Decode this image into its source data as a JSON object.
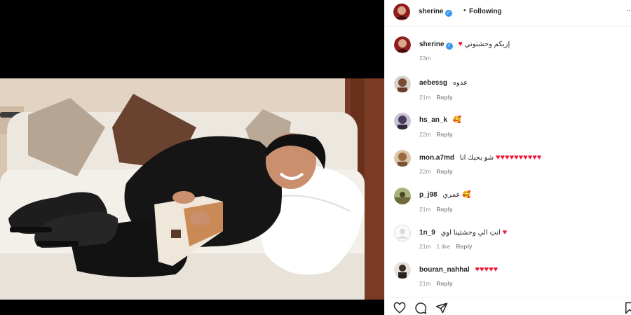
{
  "post": {
    "author": "sherine",
    "follow_dot": "•",
    "follow_status": "Following",
    "more_label": "··",
    "caption_text": "إزيكم وحشتوني",
    "caption_hearts": "♥",
    "caption_time": "23m"
  },
  "comments": [
    {
      "username": "aebessg",
      "text": "عدوه",
      "hearts": "",
      "time": "21m",
      "likes": "",
      "reply": "Reply"
    },
    {
      "username": "hs_an_k",
      "text": "🥰",
      "hearts": "",
      "time": "22m",
      "likes": "",
      "reply": "Reply"
    },
    {
      "username": "mon.a7md",
      "text": "شو بحبك انا",
      "hearts": "♥♥♥♥♥♥♥♥♥♥",
      "time": "22m",
      "likes": "",
      "reply": "Reply"
    },
    {
      "username": "p_j98",
      "text": "عمري 🥰",
      "hearts": "",
      "time": "21m",
      "likes": "",
      "reply": "Reply"
    },
    {
      "username": "1n_9",
      "text": "انتِ الي وحشتينا اوي",
      "hearts": "♥",
      "time": "21m",
      "likes": "1 like",
      "reply": "Reply"
    },
    {
      "username": "bouran_nahhal",
      "text": "",
      "hearts": "♥♥♥♥♥",
      "time": "21m",
      "likes": "",
      "reply": "Reply"
    }
  ],
  "actions": {
    "like_icon": "heart-outline-icon",
    "comment_icon": "comment-bubble-icon",
    "share_icon": "paper-plane-icon",
    "save_icon": "bookmark-icon"
  },
  "colors": {
    "verified": "#3897f0",
    "heart": "#ed1c3a",
    "meta_gray": "#8e8e8e",
    "text": "#262626"
  }
}
